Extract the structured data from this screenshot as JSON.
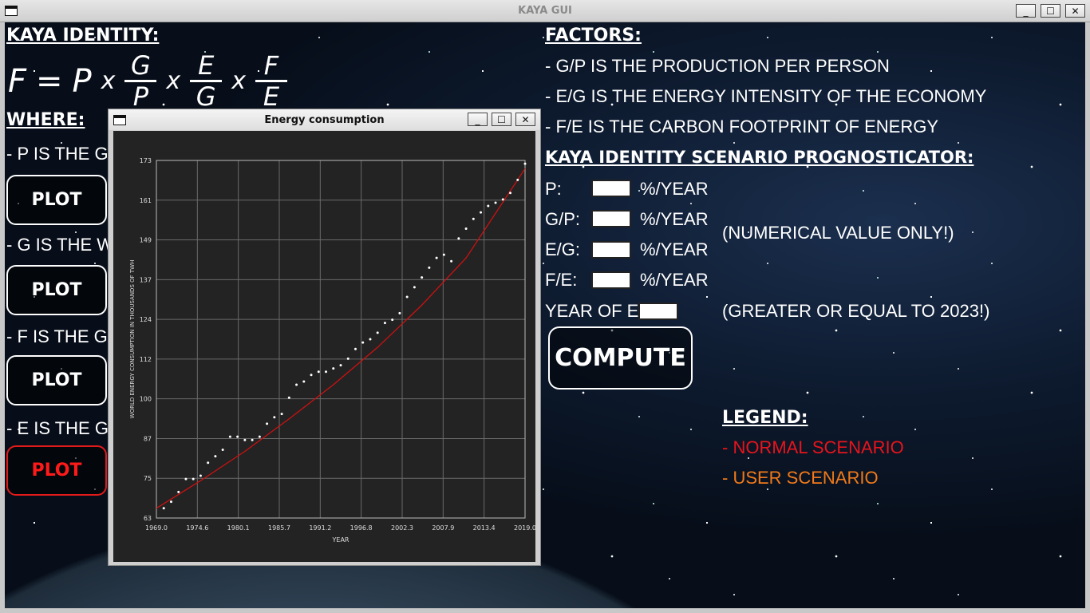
{
  "window": {
    "title": "KAYA GUI",
    "minimize": "_",
    "maximize": "☐",
    "close": "✕"
  },
  "left": {
    "kaya_header": "KAYA IDENTITY:",
    "formula": {
      "lhs": "F",
      "eq": "=",
      "p": "P",
      "x": "x",
      "g1": "G",
      "p1": "P",
      "e1": "E",
      "g2": "G",
      "f2": "F",
      "e2": "E"
    },
    "where_header": "WHERE:",
    "lines": [
      "- P IS THE GLOB",
      "- G IS THE WORL",
      "- F IS THE GLOBI",
      "- E IS THE GLOBI"
    ],
    "plot_label": "PLOT"
  },
  "right": {
    "factors_header": "FACTORS:",
    "factors": [
      "- G/P IS THE PRODUCTION PER PERSON",
      "- E/G IS THE ENERGY INTENSITY OF THE ECONOMY",
      "- F/E IS THE CARBON FOOTPRINT OF ENERGY"
    ],
    "prog_header": "KAYA IDENTITY SCENARIO PROGNOSTICATOR:",
    "inputs": [
      {
        "label": "P:",
        "unit": "%/YEAR",
        "value": ""
      },
      {
        "label": "G/P:",
        "unit": "%/YEAR",
        "value": ""
      },
      {
        "label": "E/G:",
        "unit": "%/YEAR",
        "value": ""
      },
      {
        "label": "F/E:",
        "unit": "%/YEAR",
        "value": ""
      }
    ],
    "numeric_note": "(NUMERICAL VALUE ONLY!)",
    "year_label": "YEAR OF END:",
    "year_value": "",
    "year_note": "(GREATER OR EQUAL TO 2023!)",
    "compute": "COMPUTE",
    "legend_header": "LEGEND:",
    "legend_normal": "- NORMAL SCENARIO",
    "legend_user": "- USER SCENARIO",
    "legend_normal_color": "#e8141c",
    "legend_user_color": "#f07a1a"
  },
  "chart_window": {
    "title": "Energy consumption"
  },
  "chart_data": {
    "type": "scatter",
    "xlabel": "YEAR",
    "ylabel": "WORLD ENERGY CONSUMPTION IN THOUSANDS OF TWH",
    "xlim": [
      1969.0,
      2019.0
    ],
    "ylim": [
      63,
      173
    ],
    "xticks": [
      "1969.0",
      "1974.6",
      "1980.1",
      "1985.7",
      "1991.2",
      "1996.8",
      "2002.3",
      "2007.9",
      "2013.4",
      "2019.0"
    ],
    "yticks": [
      "63",
      "75",
      "87",
      "100",
      "112",
      "124",
      "137",
      "149",
      "161",
      "173"
    ],
    "grid": true,
    "series": [
      {
        "x": [
          1970,
          1971,
          1972,
          1973,
          1974,
          1975,
          1976,
          1977,
          1978,
          1979,
          1980,
          1981,
          1982,
          1983,
          1984,
          1985,
          1986,
          1987,
          1988,
          1989,
          1990,
          1991,
          1992,
          1993,
          1994,
          1995,
          1996,
          1997,
          1998,
          1999,
          2000,
          2001,
          2002,
          2003,
          2004,
          2005,
          2006,
          2007,
          2008,
          2009,
          2010,
          2011,
          2012,
          2013,
          2014,
          2015,
          2016,
          2017,
          2018,
          2019
        ],
        "y": [
          66,
          68,
          71,
          75,
          75,
          76,
          80,
          82,
          84,
          88,
          88,
          87,
          87,
          88,
          92,
          94,
          95,
          100,
          104,
          105,
          107,
          108,
          108,
          109,
          110,
          112,
          115,
          117,
          118,
          120,
          123,
          124,
          126,
          131,
          134,
          137,
          140,
          143,
          144,
          142,
          149,
          152,
          155,
          157,
          159,
          160,
          161,
          163,
          167,
          172
        ],
        "color": "#ffffff"
      }
    ],
    "trend": {
      "x": [
        1969,
        1975,
        1981,
        1987,
        1993,
        1999,
        2005,
        2011,
        2019
      ],
      "y": [
        66,
        74.5,
        83.5,
        93.5,
        104,
        115.5,
        128.5,
        143,
        170.5
      ],
      "color": "#cc1111"
    }
  }
}
